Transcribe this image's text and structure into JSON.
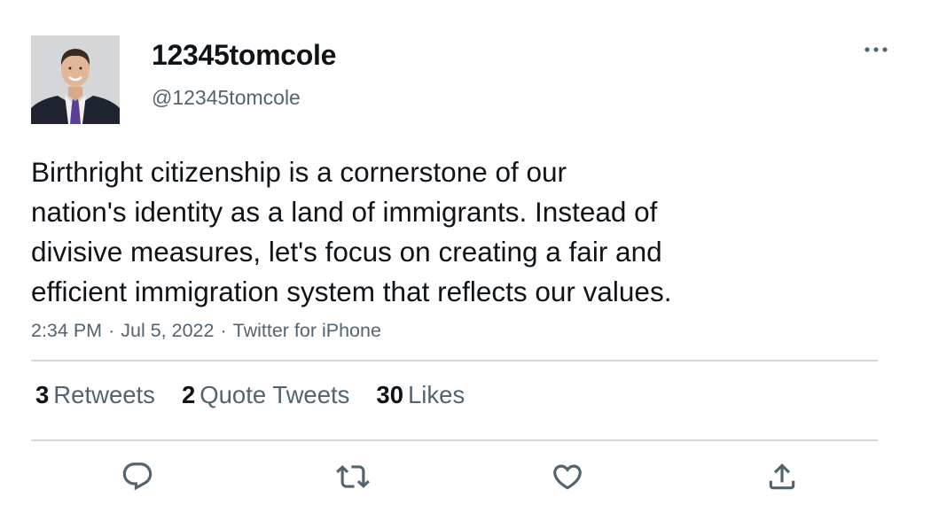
{
  "author": {
    "display_name": "12345tomcole",
    "handle": "@12345tomcole"
  },
  "tweet": {
    "text_lines": [
      "Birthright citizenship is a cornerstone of our",
      "nation's identity as a land of immigrants. Instead of",
      "divisive measures, let's focus on creating a fair and",
      "efficient immigration system that reflects our values."
    ],
    "time": "2:34 PM",
    "separator": "·",
    "date": "Jul 5, 2022",
    "source": "Twitter for iPhone"
  },
  "stats": {
    "retweets": {
      "count": "3",
      "label": "Retweets"
    },
    "quote_tweets": {
      "count": "2",
      "label": "Quote Tweets"
    },
    "likes": {
      "count": "30",
      "label": "Likes"
    }
  },
  "actions": {
    "reply_icon": "reply-icon",
    "retweet_icon": "retweet-icon",
    "like_icon": "heart-icon",
    "share_icon": "share-icon"
  },
  "colors": {
    "text_primary": "#0f1419",
    "text_secondary": "#536471",
    "divider": "#cfd9de",
    "icon": "#536471"
  }
}
